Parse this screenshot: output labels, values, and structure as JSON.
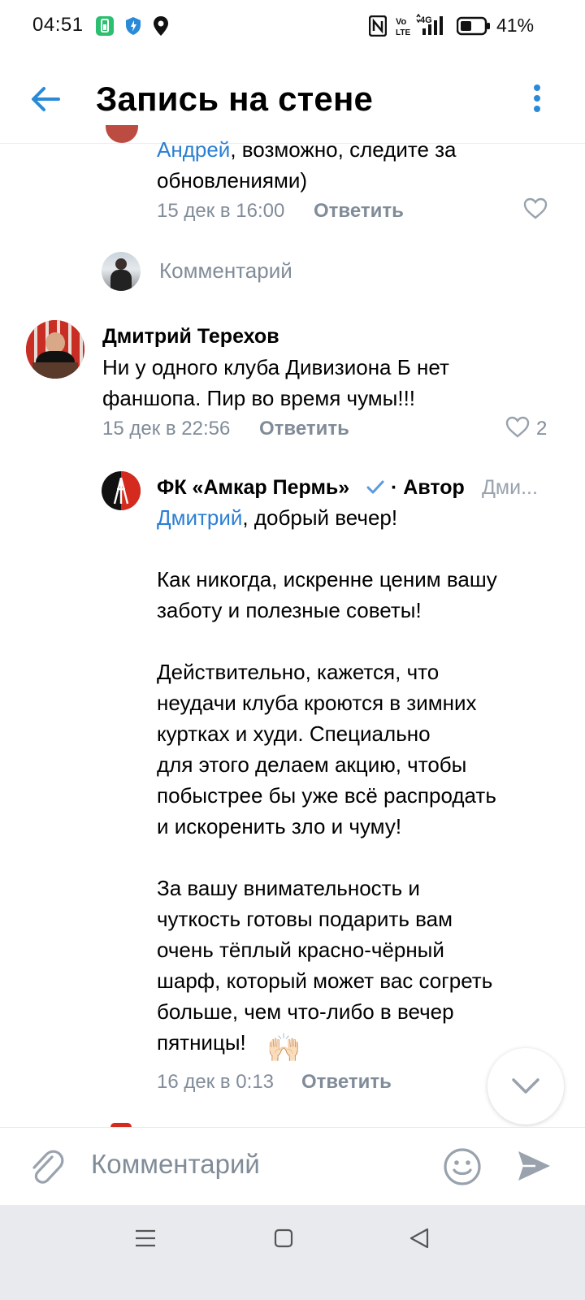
{
  "status": {
    "time": "04:51",
    "battery": "41%",
    "icons": [
      "battery-saver-icon",
      "shield-icon",
      "location-icon",
      "nfc-icon",
      "volte-icon",
      "signal-4g-icon",
      "battery-icon"
    ]
  },
  "header": {
    "title": "Запись на стене",
    "back_icon": "arrow-left-icon",
    "menu_icon": "vertical-dots-icon"
  },
  "reply_top": {
    "mention": "Андрей",
    "text_line1": ", возможно, следите за",
    "text_line2": "обновлениями)",
    "date": "15 дек в 16:00",
    "reply_label": "Ответить"
  },
  "inline_comment": {
    "placeholder": "Комментарий"
  },
  "comment_main": {
    "author": "Дмитрий Терехов",
    "text": "Ни у одного клуба Дивизиона Б нет\nфаншопа. Пир во время чумы!!!",
    "date": "15 дек в 22:56",
    "reply_label": "Ответить",
    "likes": "2"
  },
  "reply_club": {
    "author": "ФК «Амкар Пермь»",
    "author_tag": "· Автор",
    "reply_to": "Дми...",
    "mention": "Дмитрий",
    "greeting": ", добрый вечер!",
    "body": "Как никогда, искренне ценим вашу\nзаботу и полезные советы!\n\nДействительно, кажется, что\nнеудачи клуба кроются в зимних\nкуртках и худи. Специально\nдля этого делаем акцию, чтобы\nпобыстрее бы уже всё распродать\nи искоренить зло и чуму!\n\nЗа вашу внимательность и\nчуткость готовы подарить вам\nочень тёплый красно-чёрный\nшарф, который может вас согреть\nбольше, чем что-либо в вечер\nпятницы!",
    "emoji": "🙌🏻",
    "date": "16 дек в 0:13",
    "reply_label": "Ответить"
  },
  "composer": {
    "placeholder": "Комментарий"
  },
  "colors": {
    "link": "#2a7fd4",
    "meta": "#818c99",
    "accent": "#2a8ad8",
    "club_red": "#d52b1e"
  }
}
